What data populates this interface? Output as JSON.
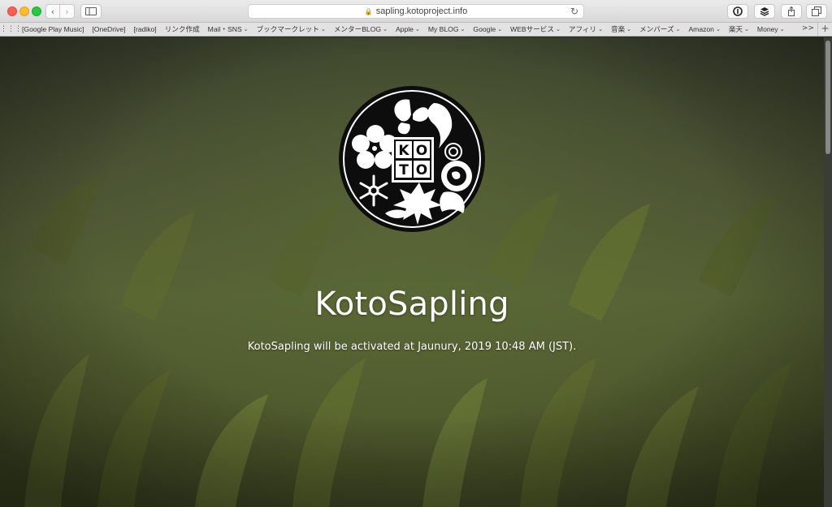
{
  "browser": {
    "url": "sapling.kotoproject.info",
    "bookmarks": [
      {
        "label": "[Google Play Music]",
        "menu": false
      },
      {
        "label": "[OneDrive]",
        "menu": false
      },
      {
        "label": "[radiko]",
        "menu": false
      },
      {
        "label": "リンク作成",
        "menu": false
      },
      {
        "label": "Mail・SNS",
        "menu": true
      },
      {
        "label": "ブックマークレット",
        "menu": true
      },
      {
        "label": "メンターBLOG",
        "menu": true
      },
      {
        "label": "Apple",
        "menu": true
      },
      {
        "label": "My BLOG",
        "menu": true
      },
      {
        "label": "Google",
        "menu": true
      },
      {
        "label": "WEBサービス",
        "menu": true
      },
      {
        "label": "アフィリ",
        "menu": true
      },
      {
        "label": "音楽",
        "menu": true
      },
      {
        "label": "メンバーズ",
        "menu": true
      },
      {
        "label": "Amazon",
        "menu": true
      },
      {
        "label": "楽天",
        "menu": true
      },
      {
        "label": "Money",
        "menu": true
      }
    ]
  },
  "page": {
    "logo_letters": [
      "K",
      "O",
      "T",
      "O"
    ],
    "title": "KotoSapling",
    "subtitle": "KotoSapling will be activated at Jaunury, 2019 10:48 AM (JST)."
  },
  "colors": {
    "background_green": "#4f5a2d",
    "logo_black": "#0d0d0d",
    "text_white": "#ffffff"
  }
}
